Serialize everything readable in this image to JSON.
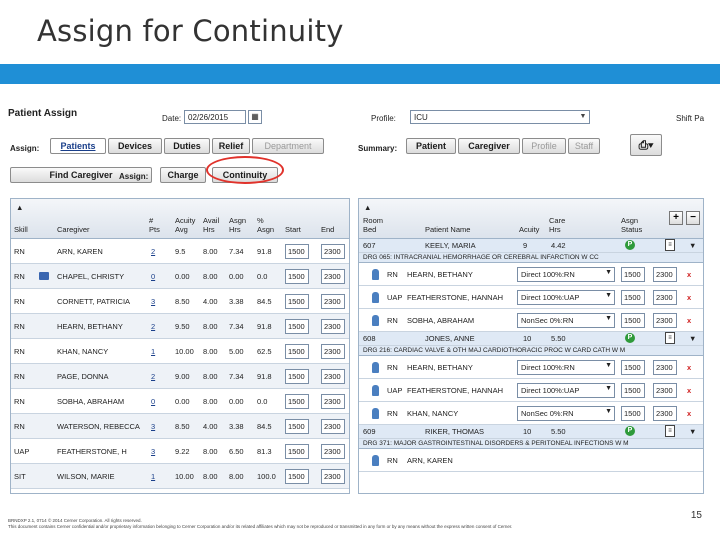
{
  "slide": {
    "title": "Assign for Continuity",
    "page_number": "15"
  },
  "footer": {
    "line1": "BRNDXP 2.1, 0714    © 2014 Cerner Corporation. All rights reserved.",
    "line2": "This document contains Cerner confidential and/or proprietary information belonging to Cerner Corporation and/or its related affiliates which may not be reproduced or transmitted in any form or by any means without the express written consent of Cerner."
  },
  "app": {
    "title": "Patient Assign",
    "date_label": "Date:",
    "date_value": "02/26/2015",
    "profile_label": "Profile:",
    "profile_value": "ICU",
    "shift_label": "Shift Pa",
    "assign_label": "Assign:",
    "assign_tabs": [
      "Patients",
      "Devices",
      "Duties",
      "Relief",
      "Department"
    ],
    "summary_label": "Summary:",
    "summary_tabs": [
      "Patient",
      "Caregiver",
      "Profile",
      "Staff"
    ],
    "find_caregiver": "Find Caregiver",
    "assign_label2": "Assign:",
    "assign_modes": [
      "Charge",
      "Continuity"
    ],
    "colors": {
      "accent": "#1f8fd6",
      "circle": "#e0322b",
      "status_green": "#2e9a3a",
      "remove_red": "#d02020"
    }
  },
  "left_grid": {
    "headers": [
      "Skill",
      "Caregiver",
      "#\nPts",
      "Acuity\nAvg",
      "Avail\nHrs",
      "Asgn\nHrs",
      "%\nAsgn",
      "Start",
      "End"
    ],
    "rows": [
      {
        "skill": "RN",
        "caregiver": "ARN, KAREN",
        "pts": "2",
        "acuity": "9.5",
        "avail": "8.00",
        "asgn": "7.34",
        "pct": "91.8",
        "start": "1500",
        "end": "2300",
        "charge": false
      },
      {
        "skill": "RN",
        "caregiver": "CHAPEL, CHRISTY",
        "pts": "0",
        "acuity": "0.00",
        "avail": "8.00",
        "asgn": "0.00",
        "pct": "0.0",
        "start": "1500",
        "end": "2300",
        "charge": true
      },
      {
        "skill": "RN",
        "caregiver": "CORNETT, PATRICIA",
        "pts": "3",
        "acuity": "8.50",
        "avail": "4.00",
        "asgn": "3.38",
        "pct": "84.5",
        "start": "1500",
        "end": "2300",
        "charge": false
      },
      {
        "skill": "RN",
        "caregiver": "HEARN, BETHANY",
        "pts": "2",
        "acuity": "9.50",
        "avail": "8.00",
        "asgn": "7.34",
        "pct": "91.8",
        "start": "1500",
        "end": "2300",
        "charge": false
      },
      {
        "skill": "RN",
        "caregiver": "KHAN, NANCY",
        "pts": "1",
        "acuity": "10.00",
        "avail": "8.00",
        "asgn": "5.00",
        "pct": "62.5",
        "start": "1500",
        "end": "2300",
        "charge": false
      },
      {
        "skill": "RN",
        "caregiver": "PAGE, DONNA",
        "pts": "2",
        "acuity": "9.00",
        "avail": "8.00",
        "asgn": "7.34",
        "pct": "91.8",
        "start": "1500",
        "end": "2300",
        "charge": false
      },
      {
        "skill": "RN",
        "caregiver": "SOBHA, ABRAHAM",
        "pts": "0",
        "acuity": "0.00",
        "avail": "8.00",
        "asgn": "0.00",
        "pct": "0.0",
        "start": "1500",
        "end": "2300",
        "charge": false
      },
      {
        "skill": "RN",
        "caregiver": "WATERSON, REBECCA",
        "pts": "3",
        "acuity": "8.50",
        "avail": "4.00",
        "asgn": "3.38",
        "pct": "84.5",
        "start": "1500",
        "end": "2300",
        "charge": false
      },
      {
        "skill": "UAP",
        "caregiver": "FEATHERSTONE, H",
        "pts": "3",
        "acuity": "9.22",
        "avail": "8.00",
        "asgn": "6.50",
        "pct": "81.3",
        "start": "1500",
        "end": "2300",
        "charge": false
      },
      {
        "skill": "SIT",
        "caregiver": "WILSON, MARIE",
        "pts": "1",
        "acuity": "10.00",
        "avail": "8.00",
        "asgn": "8.00",
        "pct": "100.0",
        "start": "1500",
        "end": "2300",
        "charge": false
      }
    ]
  },
  "right_grid": {
    "headers": [
      "Room\nBed",
      "Patient Name",
      "Acuity",
      "Care\nHrs",
      "Asgn\nStatus"
    ],
    "controls": [
      "+",
      "−"
    ],
    "patients": [
      {
        "room": "607",
        "name": "KEELY, MARIA",
        "acuity": "9",
        "care_hrs": "4.42",
        "status": "P",
        "drg": "DRG 065: INTRACRANIAL HEMORRHAGE OR CEREBRAL INFARCTION W CC",
        "assignments": [
          {
            "skill": "RN",
            "caregiver": "HEARN, BETHANY",
            "type": "Direct 100%:RN",
            "start": "1500",
            "end": "2300"
          },
          {
            "skill": "UAP",
            "caregiver": "FEATHERSTONE, HANNAH",
            "type": "Direct 100%:UAP",
            "start": "1500",
            "end": "2300"
          },
          {
            "skill": "RN",
            "caregiver": "SOBHA, ABRAHAM",
            "type": "NonSec 0%:RN",
            "start": "1500",
            "end": "2300"
          }
        ]
      },
      {
        "room": "608",
        "name": "JONES, ANNE",
        "acuity": "10",
        "care_hrs": "5.50",
        "status": "P",
        "drg": "DRG 216: CARDIAC VALVE & OTH MAJ CARDIOTHORACIC PROC W CARD CATH W M",
        "assignments": [
          {
            "skill": "RN",
            "caregiver": "HEARN, BETHANY",
            "type": "Direct 100%:RN",
            "start": "1500",
            "end": "2300"
          },
          {
            "skill": "UAP",
            "caregiver": "FEATHERSTONE, HANNAH",
            "type": "Direct 100%:UAP",
            "start": "1500",
            "end": "2300"
          },
          {
            "skill": "RN",
            "caregiver": "KHAN, NANCY",
            "type": "NonSec 0%:RN",
            "start": "1500",
            "end": "2300"
          }
        ]
      },
      {
        "room": "609",
        "name": "RIKER, THOMAS",
        "acuity": "10",
        "care_hrs": "5.50",
        "status": "P",
        "drg": "DRG 371: MAJOR GASTROINTESTINAL DISORDERS & PERITONEAL INFECTIONS W M",
        "assignments": [
          {
            "skill": "RN",
            "caregiver": "ARN, KAREN",
            "type": "",
            "start": "",
            "end": ""
          }
        ]
      }
    ]
  }
}
